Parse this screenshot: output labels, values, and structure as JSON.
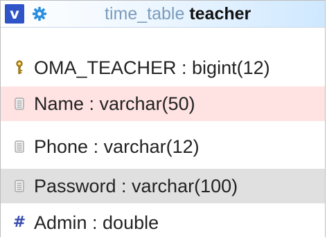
{
  "header": {
    "badge": "v",
    "settings_icon": "gear-icon",
    "database": "time_table",
    "table": "teacher"
  },
  "columns": [
    {
      "icon": "key-icon",
      "label": "OMA_TEACHER : bigint(12)"
    },
    {
      "icon": "field-icon",
      "label": "Name : varchar(50)"
    },
    {
      "icon": "field-icon",
      "label": "Phone : varchar(12)"
    },
    {
      "icon": "field-icon",
      "label": "Password : varchar(100)"
    },
    {
      "icon": "numeric-icon",
      "label": "Admin : double",
      "glyph": "#"
    }
  ],
  "colors": {
    "badge": "#2f54c8",
    "highlight_row": "#ffe2e2",
    "selected_row": "#e0e0e0"
  }
}
